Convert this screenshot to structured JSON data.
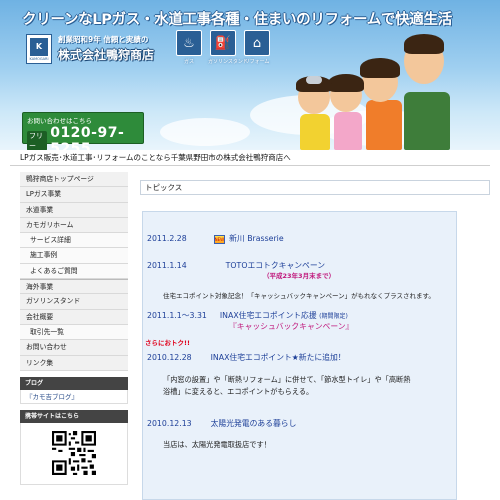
{
  "header": {
    "tagline": "クリーンなLPガス・水道工事各種・住まいのリフォームで快適生活",
    "logo_text": "KAMOGARI",
    "founded": "創業昭和9年 信頼と実績の",
    "company": "株式会社鴨狩商店",
    "services": [
      {
        "label": "ガス",
        "icon": "flame-icon"
      },
      {
        "label": "ガソリンスタンド",
        "icon": "fuel-pump-icon"
      },
      {
        "label": "リフォーム",
        "icon": "house-icon"
      }
    ],
    "contact_prompt": "お問い合わせはこちら",
    "free_dial": "フリー",
    "phone": "0120-97-5255"
  },
  "caption": "LPガス販売･水道工事･リフォームのことなら千葉県野田市の株式会社鴨狩商店へ",
  "sidebar": {
    "items": [
      {
        "label": "鴨狩商店トップページ",
        "sub": false,
        "gap": false
      },
      {
        "label": "LPガス事業",
        "sub": false,
        "gap": false
      },
      {
        "label": "水道事業",
        "sub": false,
        "gap": false
      },
      {
        "label": "カモガリホーム",
        "sub": false,
        "gap": false
      },
      {
        "label": "サービス詳細",
        "sub": true,
        "gap": false
      },
      {
        "label": "施工事例",
        "sub": true,
        "gap": false
      },
      {
        "label": "よくあるご質問",
        "sub": true,
        "gap": false
      },
      {
        "label": "海外事業",
        "sub": false,
        "gap": true
      },
      {
        "label": "ガソリンスタンド",
        "sub": false,
        "gap": false
      },
      {
        "label": "会社概要",
        "sub": false,
        "gap": false
      },
      {
        "label": "取引先一覧",
        "sub": true,
        "gap": false
      },
      {
        "label": "お問い合わせ",
        "sub": false,
        "gap": false
      },
      {
        "label": "リンク集",
        "sub": false,
        "gap": false
      }
    ],
    "blog_heading": "ブログ",
    "blog_link": "『カモ吉ブログ』",
    "mobile_heading": "携帯サイトはこちら"
  },
  "main": {
    "topics_label": "トピックス",
    "news": [
      {
        "date": "2011.2.28",
        "title": "新川  Brasserie",
        "badge": "NEW"
      },
      {
        "date": "2011.1.14",
        "title": "TOTOエコトクキャンペーン",
        "sub": "（平成23年3月末まで）"
      },
      {
        "body": "住宅エコポイント対象記念！「キャッシュバックキャンペーン」がもれなくプラスされます。"
      },
      {
        "date": "2011.1.1～3.31",
        "title": "INAX住宅エコポイント応援",
        "note": "(期間限定)"
      },
      {
        "highlight": "『キャッシュバックキャンペーン』"
      },
      {
        "extra": "さらにおトク!!"
      },
      {
        "date": "2010.12.28",
        "title": "INAX住宅エコポイント★新たに追加！"
      },
      {
        "body": "「内窓の設置」や「断熱リフォーム」に併せて、「節水型トイレ」や「高断熱"
      },
      {
        "body": "浴槽」に変えると、エコポイントがもらえる。"
      },
      {
        "date": "2010.12.13",
        "title": "太陽光発電のある暮らし"
      },
      {
        "body": "当店は、太陽光発電取扱店です！"
      }
    ]
  }
}
